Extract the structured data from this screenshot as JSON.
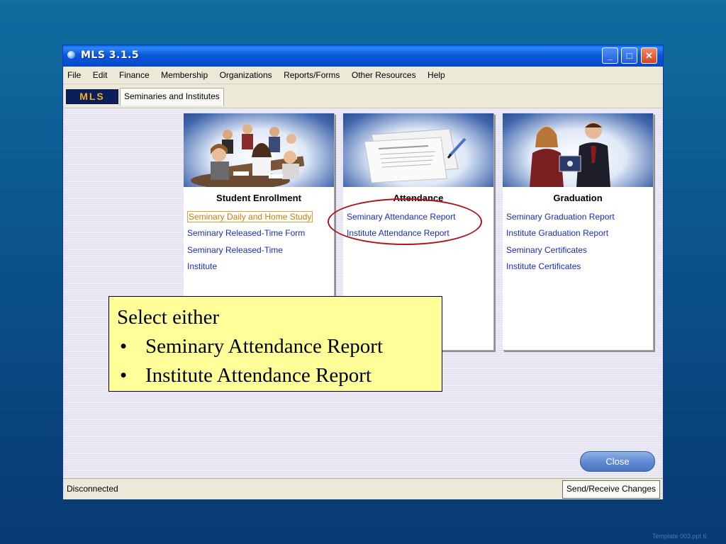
{
  "window": {
    "title": "MLS 3.1.5",
    "controls": {
      "minimize": "_",
      "maximize": "□",
      "close": "✕"
    }
  },
  "menubar": {
    "items": [
      "File",
      "Edit",
      "Finance",
      "Membership",
      "Organizations",
      "Reports/Forms",
      "Other Resources",
      "Help"
    ]
  },
  "tabbar": {
    "logo_text": "MLS",
    "active_tab": "Seminaries and Institutes"
  },
  "cards": [
    {
      "title": "Student Enrollment",
      "links": [
        "Seminary Daily and Home Study",
        "Seminary Released-Time Form",
        "Seminary Released-Time",
        "Institute"
      ],
      "selected_index": 0
    },
    {
      "title": "Attendance",
      "links": [
        "Seminary Attendance Report",
        "Institute Attendance Report"
      ]
    },
    {
      "title": "Graduation",
      "links": [
        "Seminary Graduation Report",
        "Institute Graduation Report",
        "Seminary Certificates",
        "Institute Certificates"
      ]
    }
  ],
  "buttons": {
    "close_label": "Close",
    "send_receive_label": "Send/Receive Changes"
  },
  "status": {
    "text": "Disconnected"
  },
  "callout": {
    "heading": "Select either",
    "bullet": "•",
    "items": [
      "Seminary Attendance Report",
      "Institute Attendance Report"
    ]
  },
  "footer": {
    "note": "Template 003.ppt  6"
  },
  "colors": {
    "titlebar": "#0a58db",
    "link": "#1a2bbf",
    "highlight_oval": "#b0141e",
    "callout_bg": "#ffff99",
    "mls_logo_bg": "#0c1f5c",
    "mls_logo_text": "#f0b21a"
  }
}
